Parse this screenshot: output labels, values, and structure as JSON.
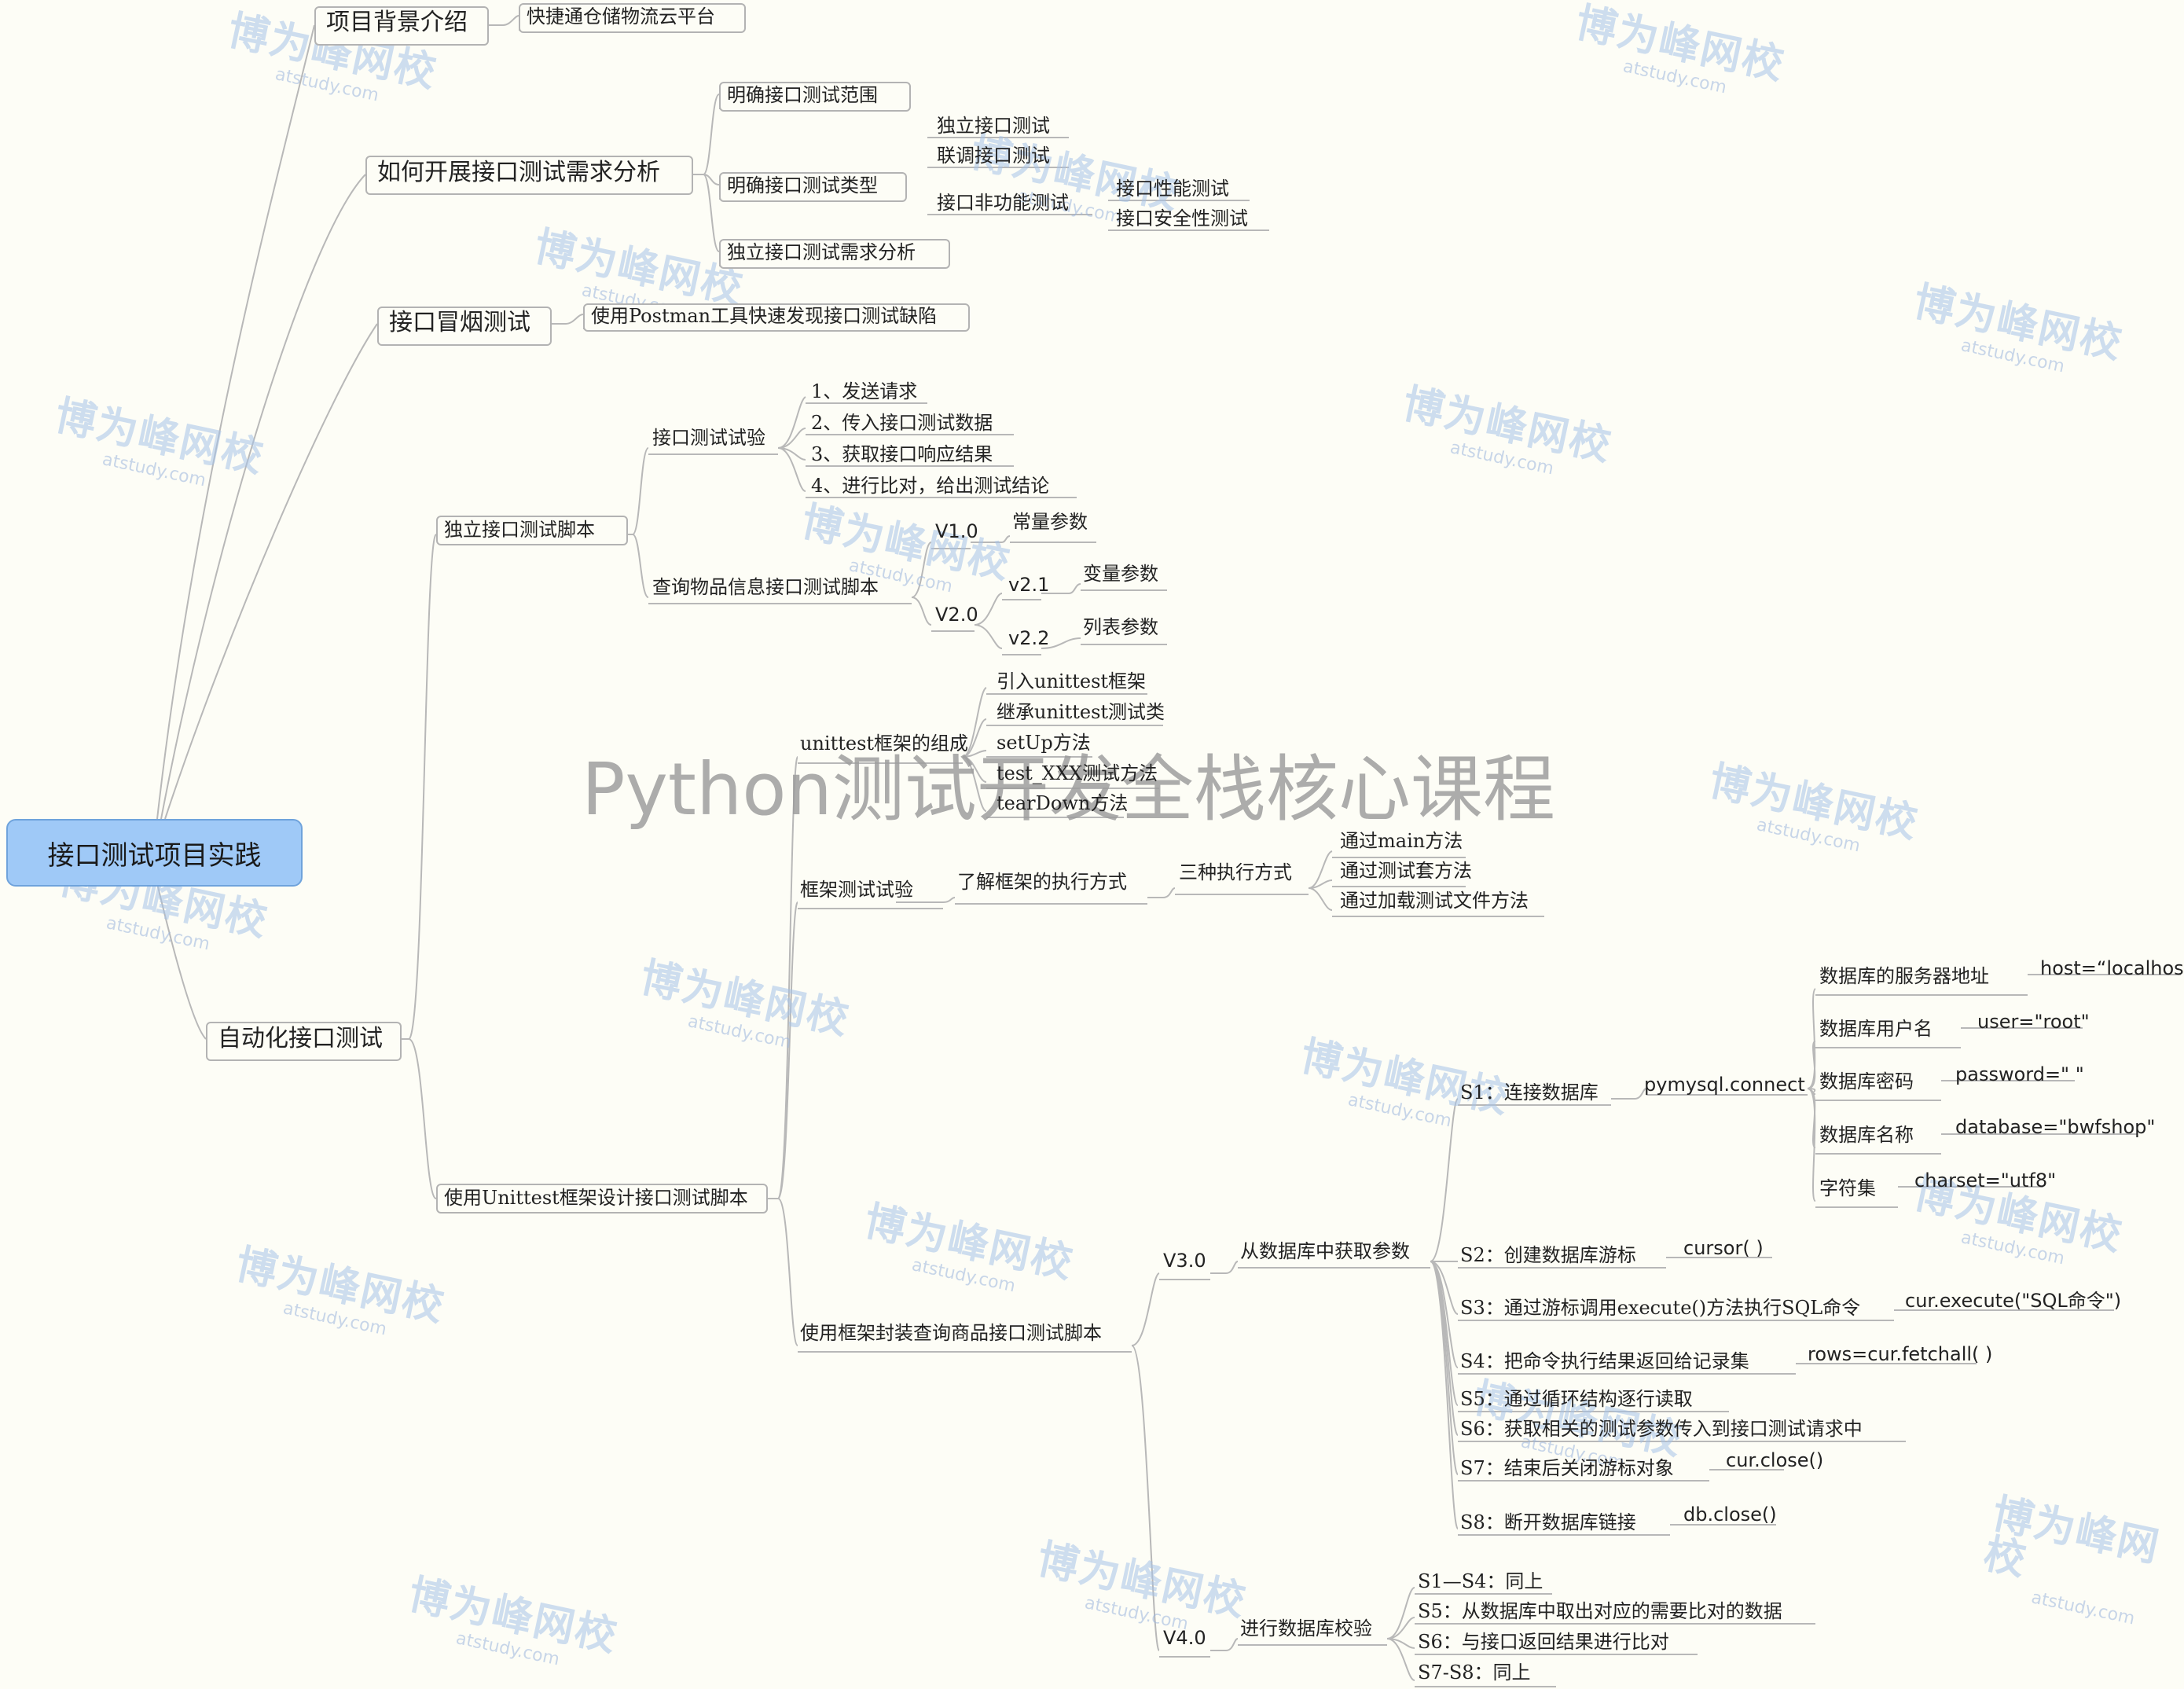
{
  "root": "接口测试项目实践",
  "center_title": "Python测试开发全栈核心课程",
  "watermark": {
    "brand": "博为峰网校",
    "url": "atstudy.com"
  },
  "level1": {
    "background": "项目背景介绍",
    "requirements": "如何开展接口测试需求分析",
    "smoke": "接口冒烟测试",
    "automation": "自动化接口测试"
  },
  "background": {
    "platform": "快捷通仓储物流云平台"
  },
  "requirements": {
    "scope": "明确接口测试范围",
    "types": "明确接口测试类型",
    "independent_analysis": "独立接口测试需求分析",
    "type_items": [
      "独立接口测试",
      "联调接口测试",
      "接口非功能测试"
    ],
    "nonfunc_items": [
      "接口性能测试",
      "接口安全性测试"
    ]
  },
  "smoke": {
    "postman": "使用Postman工具快速发现接口测试缺陷"
  },
  "automation": {
    "independent_script": "独立接口测试脚本",
    "unittest_script": "使用Unittest框架设计接口测试脚本"
  },
  "independent": {
    "experiment": "接口测试试验",
    "steps": [
      "1、发送请求",
      "2、传入接口测试数据",
      "3、获取接口响应结果",
      "4、进行比对，给出测试结论"
    ],
    "query_script": "查询物品信息接口测试脚本",
    "v10": "V1.0",
    "v10_item": "常量参数",
    "v20": "V2.0",
    "v21": "v2.1",
    "v21_item": "变量参数",
    "v22": "v2.2",
    "v22_item": "列表参数"
  },
  "unittest": {
    "composition": "unittest框架的组成",
    "composition_items": [
      "引入unittest框架",
      "继承unittest测试类",
      "setUp方法",
      "test_XXX测试方法",
      "tearDown方法"
    ],
    "experiment": "框架测试试验",
    "understand": "了解框架的执行方式",
    "three_ways": "三种执行方式",
    "ways": [
      "通过main方法",
      "通过测试套方法",
      "通过加载测试文件方法"
    ],
    "encapsulate": "使用框架封装查询商品接口测试脚本",
    "v30": "V3.0",
    "v40": "V4.0",
    "fetch_params": "从数据库中获取参数",
    "db_verify": "进行数据库校验"
  },
  "v3": {
    "s1": "S1：连接数据库",
    "s1_fn": "pymysql.connect",
    "conn_params": [
      {
        "label": "数据库的服务器地址",
        "value": "host=“localhost”"
      },
      {
        "label": "数据库用户名",
        "value": "user=\"root\""
      },
      {
        "label": "数据库密码",
        "value": "password=\" \""
      },
      {
        "label": "数据库名称",
        "value": "database=\"bwfshop\""
      },
      {
        "label": "字符集",
        "value": "charset=\"utf8\""
      }
    ],
    "s2": "S2：创建数据库游标",
    "s2_fn": "cursor(  )",
    "s3": "S3：通过游标调用execute()方法执行SQL命令",
    "s3_fn": "cur.execute(\"SQL命令\")",
    "s4": "S4：把命令执行结果返回给记录集",
    "s4_fn": "rows=cur.fetchall( )",
    "s5": "S5：通过循环结构逐行读取",
    "s6": "S6：获取相关的测试参数传入到接口测试请求中",
    "s7": "S7：结束后关闭游标对象",
    "s7_fn": "cur.close()",
    "s8": "S8：断开数据库链接",
    "s8_fn": "db.close()"
  },
  "v4": {
    "items": [
      "S1—S4：同上",
      "S5：从数据库中取出对应的需要比对的数据",
      "S6：与接口返回结果进行比对",
      "S7-S8：同上"
    ]
  }
}
